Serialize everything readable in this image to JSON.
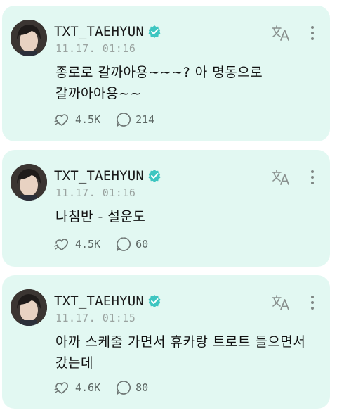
{
  "posts": [
    {
      "author": "TXT_TAEHYUN",
      "time": "11.17. 01:16",
      "text": "종로로 갈까아용~~~? 아 명동으로 갈까아아용~~",
      "likes": "4.5K",
      "comments": "214"
    },
    {
      "author": "TXT_TAEHYUN",
      "time": "11.17. 01:16",
      "text": "나침반 - 설운도",
      "likes": "4.5K",
      "comments": "60"
    },
    {
      "author": "TXT_TAEHYUN",
      "time": "11.17. 01:15",
      "text": "아까 스케줄 가면서 휴카랑 트로트 들으면서 갔는데",
      "likes": "4.6K",
      "comments": "80"
    }
  ],
  "icons": {
    "verified": "verified-badge-icon",
    "translate": "translate-icon",
    "more": "more-vertical-icon",
    "like": "like-icon",
    "comment": "comment-icon"
  },
  "colors": {
    "card_background": "#e2f8f2",
    "verified_badge": "#3ec6c1",
    "text": "#111111",
    "muted": "#9aa3a0"
  }
}
